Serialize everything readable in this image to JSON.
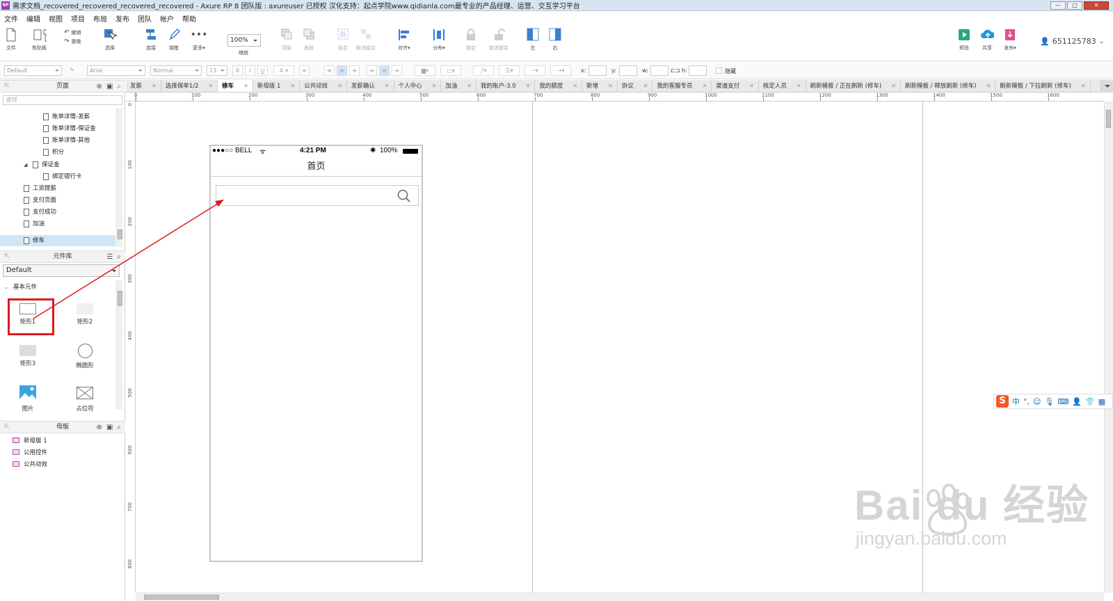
{
  "window": {
    "title": "需求文档_recovered_recovered_recovered_recovered - Axure RP 8 团队版 : axureuser 已授权 汉化支持：起点学院www.qidianla.com最专业的产品经理、运营、交互学习平台",
    "app_icon": "RP",
    "controls": {
      "minimize": "—",
      "maximize": "□",
      "close": "✕"
    }
  },
  "menu": [
    "文件",
    "编辑",
    "视图",
    "项目",
    "布局",
    "发布",
    "团队",
    "帐户",
    "帮助"
  ],
  "toolbar": {
    "file": "文件",
    "clipboard": "剪贴板",
    "undo": "撤销",
    "redo": "重做",
    "select": "选择",
    "connect": "连接",
    "pen": "钢笔",
    "more": "更多▾",
    "zoom_value": "100%",
    "zoom_label": "缩放",
    "top": "顶层",
    "bottom": "底层",
    "group": "组合",
    "ungroup": "取消组合",
    "align": "对齐▾",
    "distribute": "分布▾",
    "lock": "锁定",
    "unlock": "取消锁定",
    "left": "左",
    "right": "右",
    "preview": "预览",
    "share": "共享",
    "publish": "发布▾",
    "user": "651125783",
    "accent_color": "#3a7fd0",
    "preview_color": "#2aa876"
  },
  "format": {
    "style": "Default",
    "font": "Arial",
    "weight": "Normal",
    "size": "13",
    "x_label": "x:",
    "y_label": "y:",
    "w_label": "w:",
    "h_label": "h:",
    "hidden_label": "隐藏"
  },
  "pages_panel": {
    "title": "页面",
    "search_placeholder": "查找",
    "items": [
      {
        "label": "账单详情-发薪",
        "level": 3
      },
      {
        "label": "账单详情-保证金",
        "level": 3
      },
      {
        "label": "账单详情-其他",
        "level": 3
      },
      {
        "label": "积分",
        "level": 3
      },
      {
        "label": "保证金",
        "level": 2,
        "expanded": true
      },
      {
        "label": "绑定银行卡",
        "level": 3
      },
      {
        "label": "工资提薪",
        "level": 1
      },
      {
        "label": "支付页面",
        "level": 1
      },
      {
        "label": "支付成功",
        "level": 1
      },
      {
        "label": "加油",
        "level": 1
      },
      {
        "label": "修车",
        "level": 1,
        "selected": true
      }
    ]
  },
  "library_panel": {
    "title": "元件库",
    "library": "Default",
    "group": "基本元件",
    "widgets": [
      {
        "label": "矩形1"
      },
      {
        "label": "矩形2"
      },
      {
        "label": "矩形3"
      },
      {
        "label": "椭圆形"
      },
      {
        "label": "图片"
      },
      {
        "label": "占位符"
      }
    ]
  },
  "masters_panel": {
    "title": "母版",
    "items": [
      "新母版 1",
      "公用控件",
      "公共动效"
    ]
  },
  "tabs": [
    {
      "label": "发薪"
    },
    {
      "label": "选择保单1/2"
    },
    {
      "label": "修车",
      "active": true
    },
    {
      "label": "新母版 1"
    },
    {
      "label": "公共动效"
    },
    {
      "label": "发薪确认"
    },
    {
      "label": "个人中心"
    },
    {
      "label": "加油"
    },
    {
      "label": "我的账户-3.0"
    },
    {
      "label": "我的额度"
    },
    {
      "label": "新增"
    },
    {
      "label": "协议"
    },
    {
      "label": "我的客服专员"
    },
    {
      "label": "渠道支付"
    },
    {
      "label": "核定人员"
    },
    {
      "label": "刷新模板 / 正在刷新 (修车)"
    },
    {
      "label": "刷新模板 / 释放刷新 (修车)"
    },
    {
      "label": "刷新模板 / 下拉刷新 (修车)"
    }
  ],
  "ruler": {
    "h_ticks": [
      "0",
      "100",
      "200",
      "300",
      "400",
      "500",
      "600",
      "700",
      "800",
      "900",
      "1000",
      "1100",
      "1200",
      "1300",
      "1400",
      "1500",
      "1600"
    ],
    "v_ticks": [
      "0",
      "100",
      "200",
      "300",
      "400",
      "500",
      "600",
      "700",
      "800"
    ]
  },
  "phone": {
    "carrier": "●●●○○ BELL",
    "time": "4:21 PM",
    "battery": "100%",
    "title": "首页"
  },
  "ime": {
    "mode": "中",
    "punct": "°,"
  },
  "watermark": {
    "main": "Bai du 经验",
    "sub": "jingyan.baidu.com"
  },
  "annotation_color": "#e0191f"
}
